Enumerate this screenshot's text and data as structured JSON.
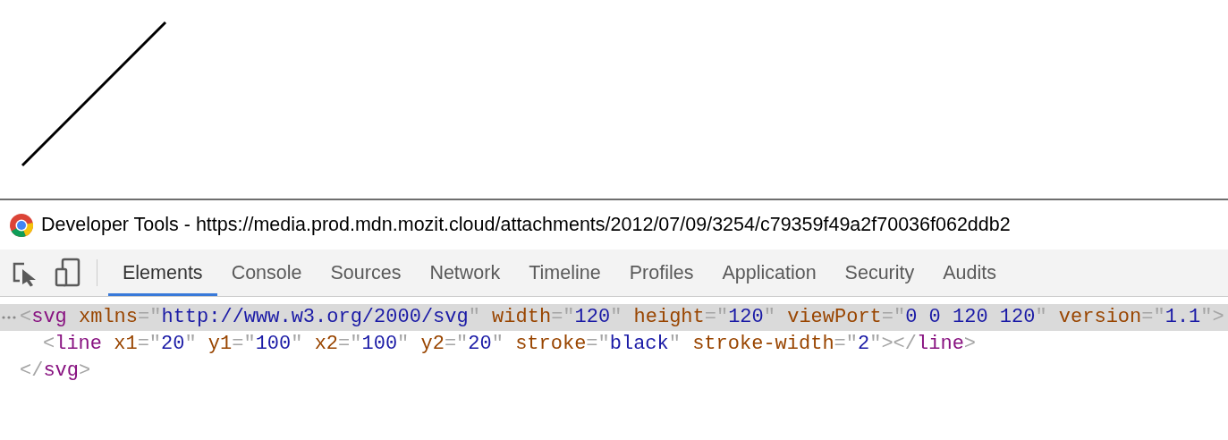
{
  "window": {
    "title": "Developer Tools - https://media.prod.mdn.mozit.cloud/attachments/2012/07/09/3254/c79359f49a2f70036f062ddb2"
  },
  "tabs": [
    {
      "label": "Elements",
      "selected": true
    },
    {
      "label": "Console",
      "selected": false
    },
    {
      "label": "Sources",
      "selected": false
    },
    {
      "label": "Network",
      "selected": false
    },
    {
      "label": "Timeline",
      "selected": false
    },
    {
      "label": "Profiles",
      "selected": false
    },
    {
      "label": "Application",
      "selected": false
    },
    {
      "label": "Security",
      "selected": false
    },
    {
      "label": "Audits",
      "selected": false
    }
  ],
  "dom_tree": [
    {
      "selected": true,
      "tokens": [
        {
          "kind": "punct",
          "text": "<"
        },
        {
          "kind": "tag",
          "text": "svg"
        },
        {
          "kind": "attr",
          "text": " xmlns"
        },
        {
          "kind": "punct",
          "text": "=\""
        },
        {
          "kind": "value",
          "text": "http://www.w3.org/2000/svg"
        },
        {
          "kind": "punct",
          "text": "\" "
        },
        {
          "kind": "attr",
          "text": "width"
        },
        {
          "kind": "punct",
          "text": "=\""
        },
        {
          "kind": "value",
          "text": "120"
        },
        {
          "kind": "punct",
          "text": "\" "
        },
        {
          "kind": "attr",
          "text": "height"
        },
        {
          "kind": "punct",
          "text": "=\""
        },
        {
          "kind": "value",
          "text": "120"
        },
        {
          "kind": "punct",
          "text": "\" "
        },
        {
          "kind": "attr",
          "text": "viewPort"
        },
        {
          "kind": "punct",
          "text": "=\""
        },
        {
          "kind": "value",
          "text": "0 0 120 120"
        },
        {
          "kind": "punct",
          "text": "\" "
        },
        {
          "kind": "attr",
          "text": "version"
        },
        {
          "kind": "punct",
          "text": "=\""
        },
        {
          "kind": "value",
          "text": "1.1"
        },
        {
          "kind": "punct",
          "text": "\">"
        }
      ],
      "children": [
        {
          "selected": false,
          "tokens": [
            {
              "kind": "punct",
              "text": "<"
            },
            {
              "kind": "tag",
              "text": "line"
            },
            {
              "kind": "attr",
              "text": " x1"
            },
            {
              "kind": "punct",
              "text": "=\""
            },
            {
              "kind": "value",
              "text": "20"
            },
            {
              "kind": "punct",
              "text": "\" "
            },
            {
              "kind": "attr",
              "text": "y1"
            },
            {
              "kind": "punct",
              "text": "=\""
            },
            {
              "kind": "value",
              "text": "100"
            },
            {
              "kind": "punct",
              "text": "\" "
            },
            {
              "kind": "attr",
              "text": "x2"
            },
            {
              "kind": "punct",
              "text": "=\""
            },
            {
              "kind": "value",
              "text": "100"
            },
            {
              "kind": "punct",
              "text": "\" "
            },
            {
              "kind": "attr",
              "text": "y2"
            },
            {
              "kind": "punct",
              "text": "=\""
            },
            {
              "kind": "value",
              "text": "20"
            },
            {
              "kind": "punct",
              "text": "\" "
            },
            {
              "kind": "attr",
              "text": "stroke"
            },
            {
              "kind": "punct",
              "text": "=\""
            },
            {
              "kind": "value",
              "text": "black"
            },
            {
              "kind": "punct",
              "text": "\" "
            },
            {
              "kind": "attr",
              "text": "stroke-width"
            },
            {
              "kind": "punct",
              "text": "=\""
            },
            {
              "kind": "value",
              "text": "2"
            },
            {
              "kind": "punct",
              "text": "\"></"
            },
            {
              "kind": "tag",
              "text": "line"
            },
            {
              "kind": "punct",
              "text": ">"
            }
          ]
        }
      ]
    },
    {
      "selected": false,
      "tokens": [
        {
          "kind": "punct",
          "text": "</"
        },
        {
          "kind": "tag",
          "text": "svg"
        },
        {
          "kind": "punct",
          "text": ">"
        }
      ]
    }
  ]
}
